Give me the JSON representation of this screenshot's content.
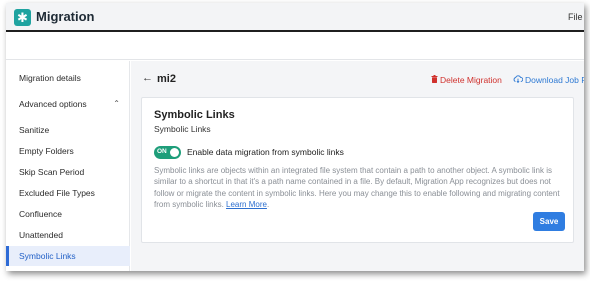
{
  "app": {
    "title": "Migration",
    "top_menu_label": "File",
    "brand_color": "#1fa3a0",
    "logo_icon": "asterisk-icon"
  },
  "sidebar": {
    "items": [
      {
        "label": "Migration details",
        "active": false
      },
      {
        "label": "Advanced options",
        "active": false,
        "expanded": true
      },
      {
        "label": "Sanitize",
        "active": false
      },
      {
        "label": "Empty Folders",
        "active": false
      },
      {
        "label": "Skip Scan Period",
        "active": false
      },
      {
        "label": "Excluded File Types",
        "active": false
      },
      {
        "label": "Confluence",
        "active": false
      },
      {
        "label": "Unattended",
        "active": false
      },
      {
        "label": "Symbolic Links",
        "active": true
      }
    ]
  },
  "header": {
    "title": "mi2",
    "delete_label": "Delete Migration",
    "download_label": "Download Job Re",
    "delete_color": "#d0312d",
    "download_color": "#2d79d3"
  },
  "card": {
    "title": "Symbolic Links",
    "subtitle": "Symbolic Links",
    "toggle_state": "ON",
    "toggle_label": "Enable data migration from symbolic links",
    "toggle_color": "#1e9e7a",
    "description": "Symbolic links are objects within an integrated file system that contain a path to another object. A symbolic link is similar to a shortcut in that it's a path name contained in a file. By default, Migration App recognizes but does not follow or migrate the content in symbolic links. Here you may change this to enable following and migrating content from symbolic links.",
    "learn_more_label": "Learn More",
    "save_label": "Save",
    "save_color": "#2f7de1"
  }
}
